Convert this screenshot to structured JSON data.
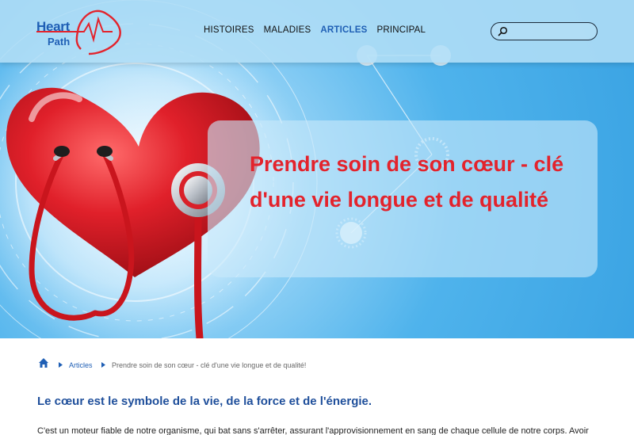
{
  "brand": {
    "line1": "Heart",
    "line2": "Path",
    "color": "#1f5fb5",
    "accent": "#e3232c"
  },
  "nav": {
    "items": [
      {
        "label": "HISTOIRES",
        "active": false
      },
      {
        "label": "MALADIES",
        "active": false
      },
      {
        "label": "ARTICLES",
        "active": true
      },
      {
        "label": "PRINCIPAL",
        "active": false
      }
    ]
  },
  "search": {
    "icon": "search-icon",
    "placeholder": "",
    "value": ""
  },
  "hero": {
    "title": "Prendre soin de son cœur - clé d'une vie longue et de qualité",
    "title_color": "#e3232c"
  },
  "breadcrumb": {
    "home_icon": "home-icon",
    "link": "Articles",
    "current": "Prendre soin de son cœur - clé d'une vie longue et de qualité!"
  },
  "article": {
    "heading": "Le cœur est le symbole de la vie, de la force et de l'énergie.",
    "paragraph": "C'est un moteur fiable de notre organisme, qui bat sans s'arrêter, assurant l'approvisionnement en sang de chaque cellule de notre corps. Avoir"
  }
}
